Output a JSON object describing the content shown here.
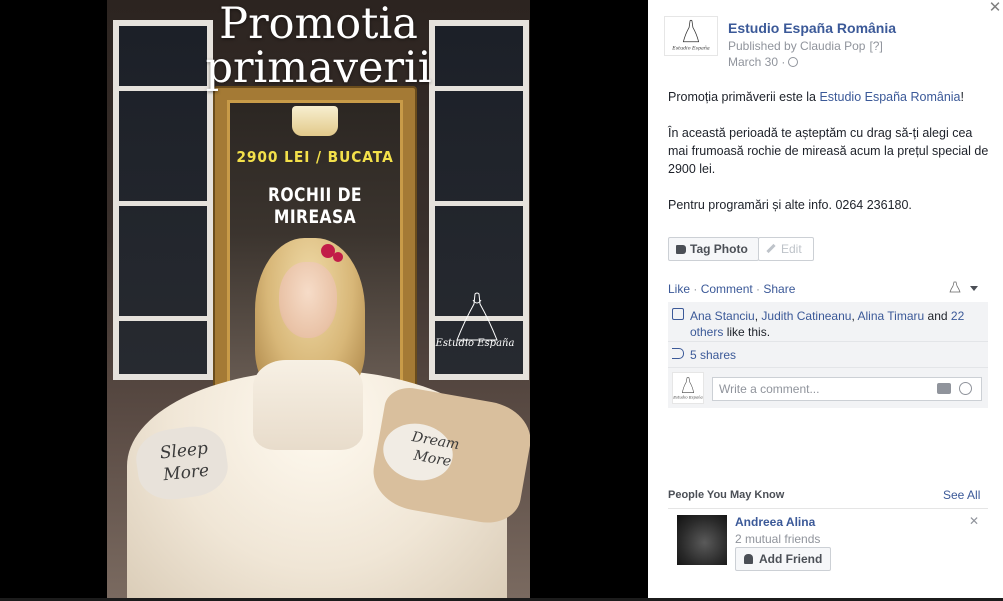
{
  "photo": {
    "title_line1": "Promotia",
    "title_line2": "primaverii",
    "price": "2900 LEI / BUCATA",
    "dress_label": "ROCHII DE MIREASA",
    "brand_watermark": "Estudio España",
    "pillow_left_line1": "Sleep",
    "pillow_left_line2": "More",
    "pillow_right_line1": "Dream",
    "pillow_right_line2": "More"
  },
  "post": {
    "page_name": "Estudio España România",
    "published_by": "Published by Claudia Pop",
    "published_help": "[?]",
    "date": "March 30 ·",
    "p1_text": "Promoția primăverii este la ",
    "p1_link": "Estudio España România",
    "p1_end": "!",
    "p2": "În această perioadă te așteptăm cu drag să-ți alegi cea mai frumoasă rochie de mireasă acum la prețul special de 2900 lei.",
    "p3": "Pentru programări și alte info. 0264 236180."
  },
  "buttons": {
    "tag_photo": "Tag Photo",
    "edit": "Edit"
  },
  "actions": {
    "like": "Like",
    "sep1": " · ",
    "comment": "Comment",
    "sep2": " · ",
    "share": "Share"
  },
  "ufi": {
    "likers": [
      "Ana Stanciu",
      "Judith Catineanu",
      "Alina Timaru"
    ],
    "sep_comma1": ", ",
    "sep_comma2": ", ",
    "and_text": " and ",
    "others": "22 others",
    "like_suffix": " like this.",
    "shares": "5 shares",
    "comment_placeholder": "Write a comment..."
  },
  "pymk": {
    "heading": "People You May Know",
    "see_all": "See All",
    "person_name": "Andreea Alina",
    "mutual": "2 mutual friends",
    "add_friend": "Add Friend"
  },
  "colors": {
    "link": "#3b5998",
    "price_yellow": "#f3e04a",
    "frame_gold": "#a47a35"
  },
  "icons": [
    "close-icon",
    "globe-icon",
    "tag-icon",
    "pencil-icon",
    "thumbs-up-icon",
    "share-icon",
    "camera-icon",
    "smiley-icon",
    "add-friend-icon",
    "dismiss-icon",
    "dropdown-caret-icon"
  ]
}
